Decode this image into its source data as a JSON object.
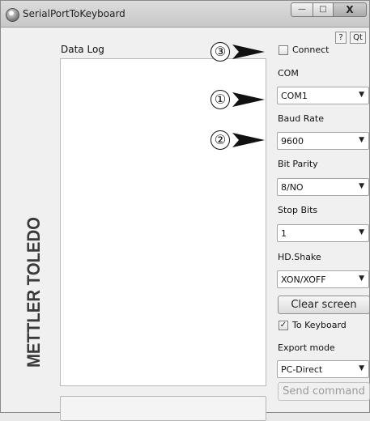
{
  "window": {
    "title": "SerialPortToKeyboard",
    "min_symbol": "—",
    "max_symbol": "□",
    "close_symbol": "X"
  },
  "toolbar": {
    "help_label": "?",
    "qt_label": "Qt"
  },
  "data_log": {
    "label": "Data Log",
    "content": ""
  },
  "brand": {
    "logo_text": "METTLER TOLEDO"
  },
  "command_input": {
    "value": ""
  },
  "settings": {
    "connect": {
      "label": "Connect",
      "checked": false
    },
    "com": {
      "label": "COM",
      "value": "COM1"
    },
    "baud_rate": {
      "label": "Baud Rate",
      "value": "9600"
    },
    "bit_parity": {
      "label": "Bit Parity",
      "value": "8/NO"
    },
    "stop_bits": {
      "label": "Stop Bits",
      "value": "1"
    },
    "handshake": {
      "label": "HD.Shake",
      "value": "XON/XOFF"
    },
    "clear_screen_label": "Clear screen",
    "to_keyboard": {
      "label": "To Keyboard",
      "checked": true,
      "check_glyph": "✓"
    },
    "export_mode": {
      "label": "Export mode",
      "value": "PC-Direct"
    },
    "send_command_label": "Send command"
  },
  "callouts": [
    {
      "number": "③"
    },
    {
      "number": "①"
    },
    {
      "number": "②"
    }
  ],
  "icons": {
    "dropdown": "▼",
    "callout_arrow": "arrow-right-icon"
  },
  "colors": {
    "logo": "#3a3a3a",
    "window_bg": "#f0f0f0",
    "titlebar": "#cfcfcf"
  }
}
